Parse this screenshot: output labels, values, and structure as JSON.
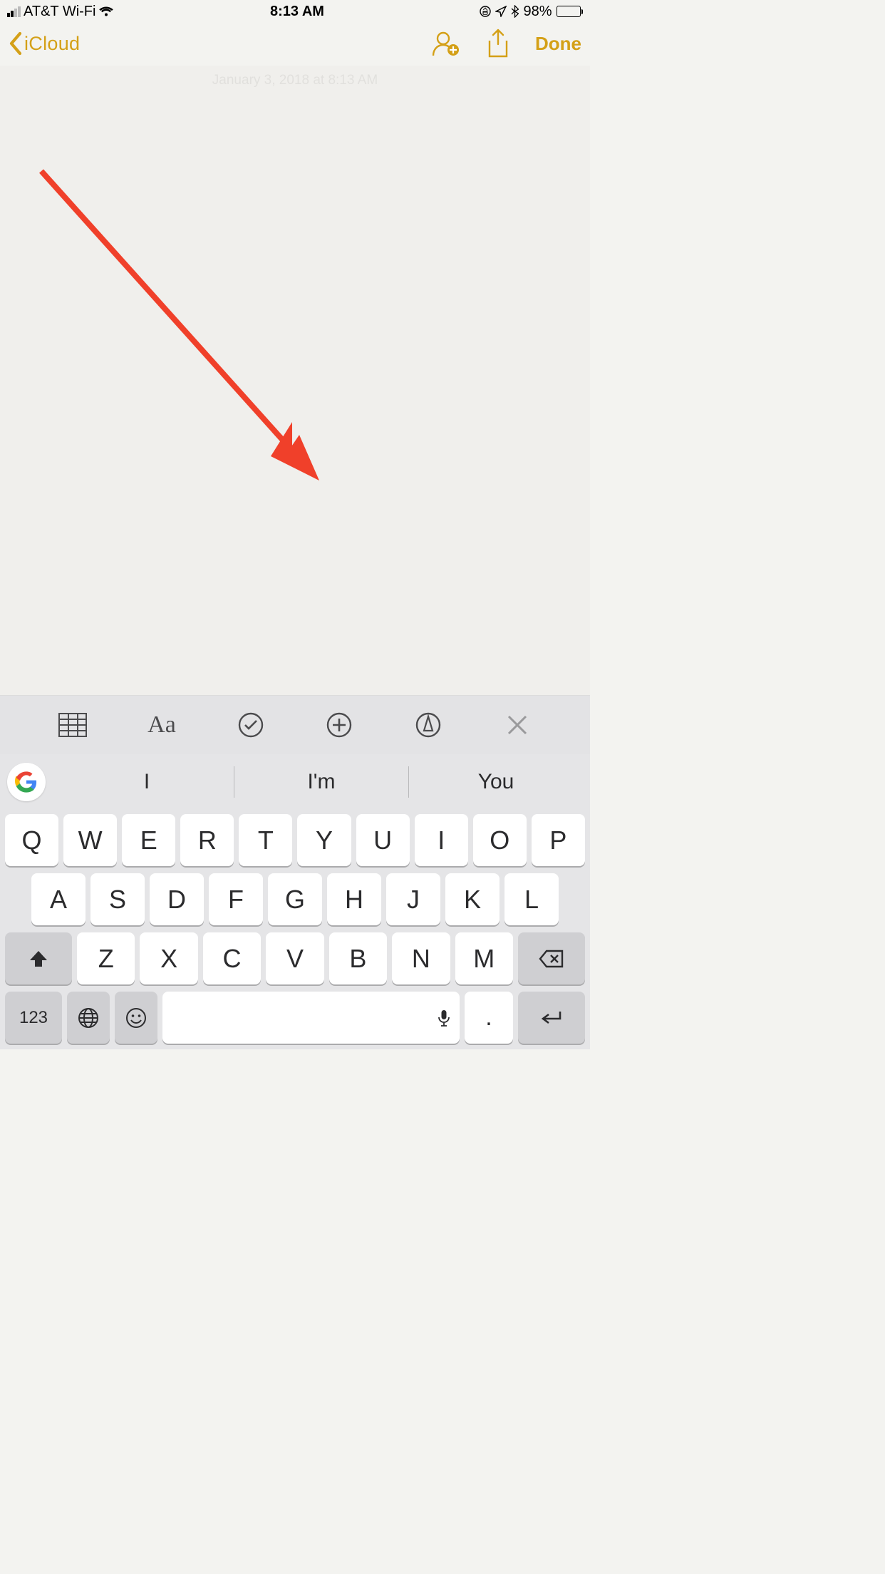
{
  "status": {
    "carrier": "AT&T Wi-Fi",
    "time": "8:13 AM",
    "battery_pct": "98%"
  },
  "nav": {
    "back_label": "iCloud",
    "done_label": "Done"
  },
  "note": {
    "date_stamp": "January 3, 2018 at 8:13 AM"
  },
  "format_bar": {
    "text_style": "Aa"
  },
  "suggestions": [
    "I",
    "I'm",
    "You"
  ],
  "keyboard": {
    "row1": [
      "Q",
      "W",
      "E",
      "R",
      "T",
      "Y",
      "U",
      "I",
      "O",
      "P"
    ],
    "row2": [
      "A",
      "S",
      "D",
      "F",
      "G",
      "H",
      "J",
      "K",
      "L"
    ],
    "row3": [
      "Z",
      "X",
      "C",
      "V",
      "B",
      "N",
      "M"
    ],
    "num_label": "123",
    "period": "."
  },
  "colors": {
    "accent": "#d4a017",
    "annotation": "#f0402a"
  }
}
